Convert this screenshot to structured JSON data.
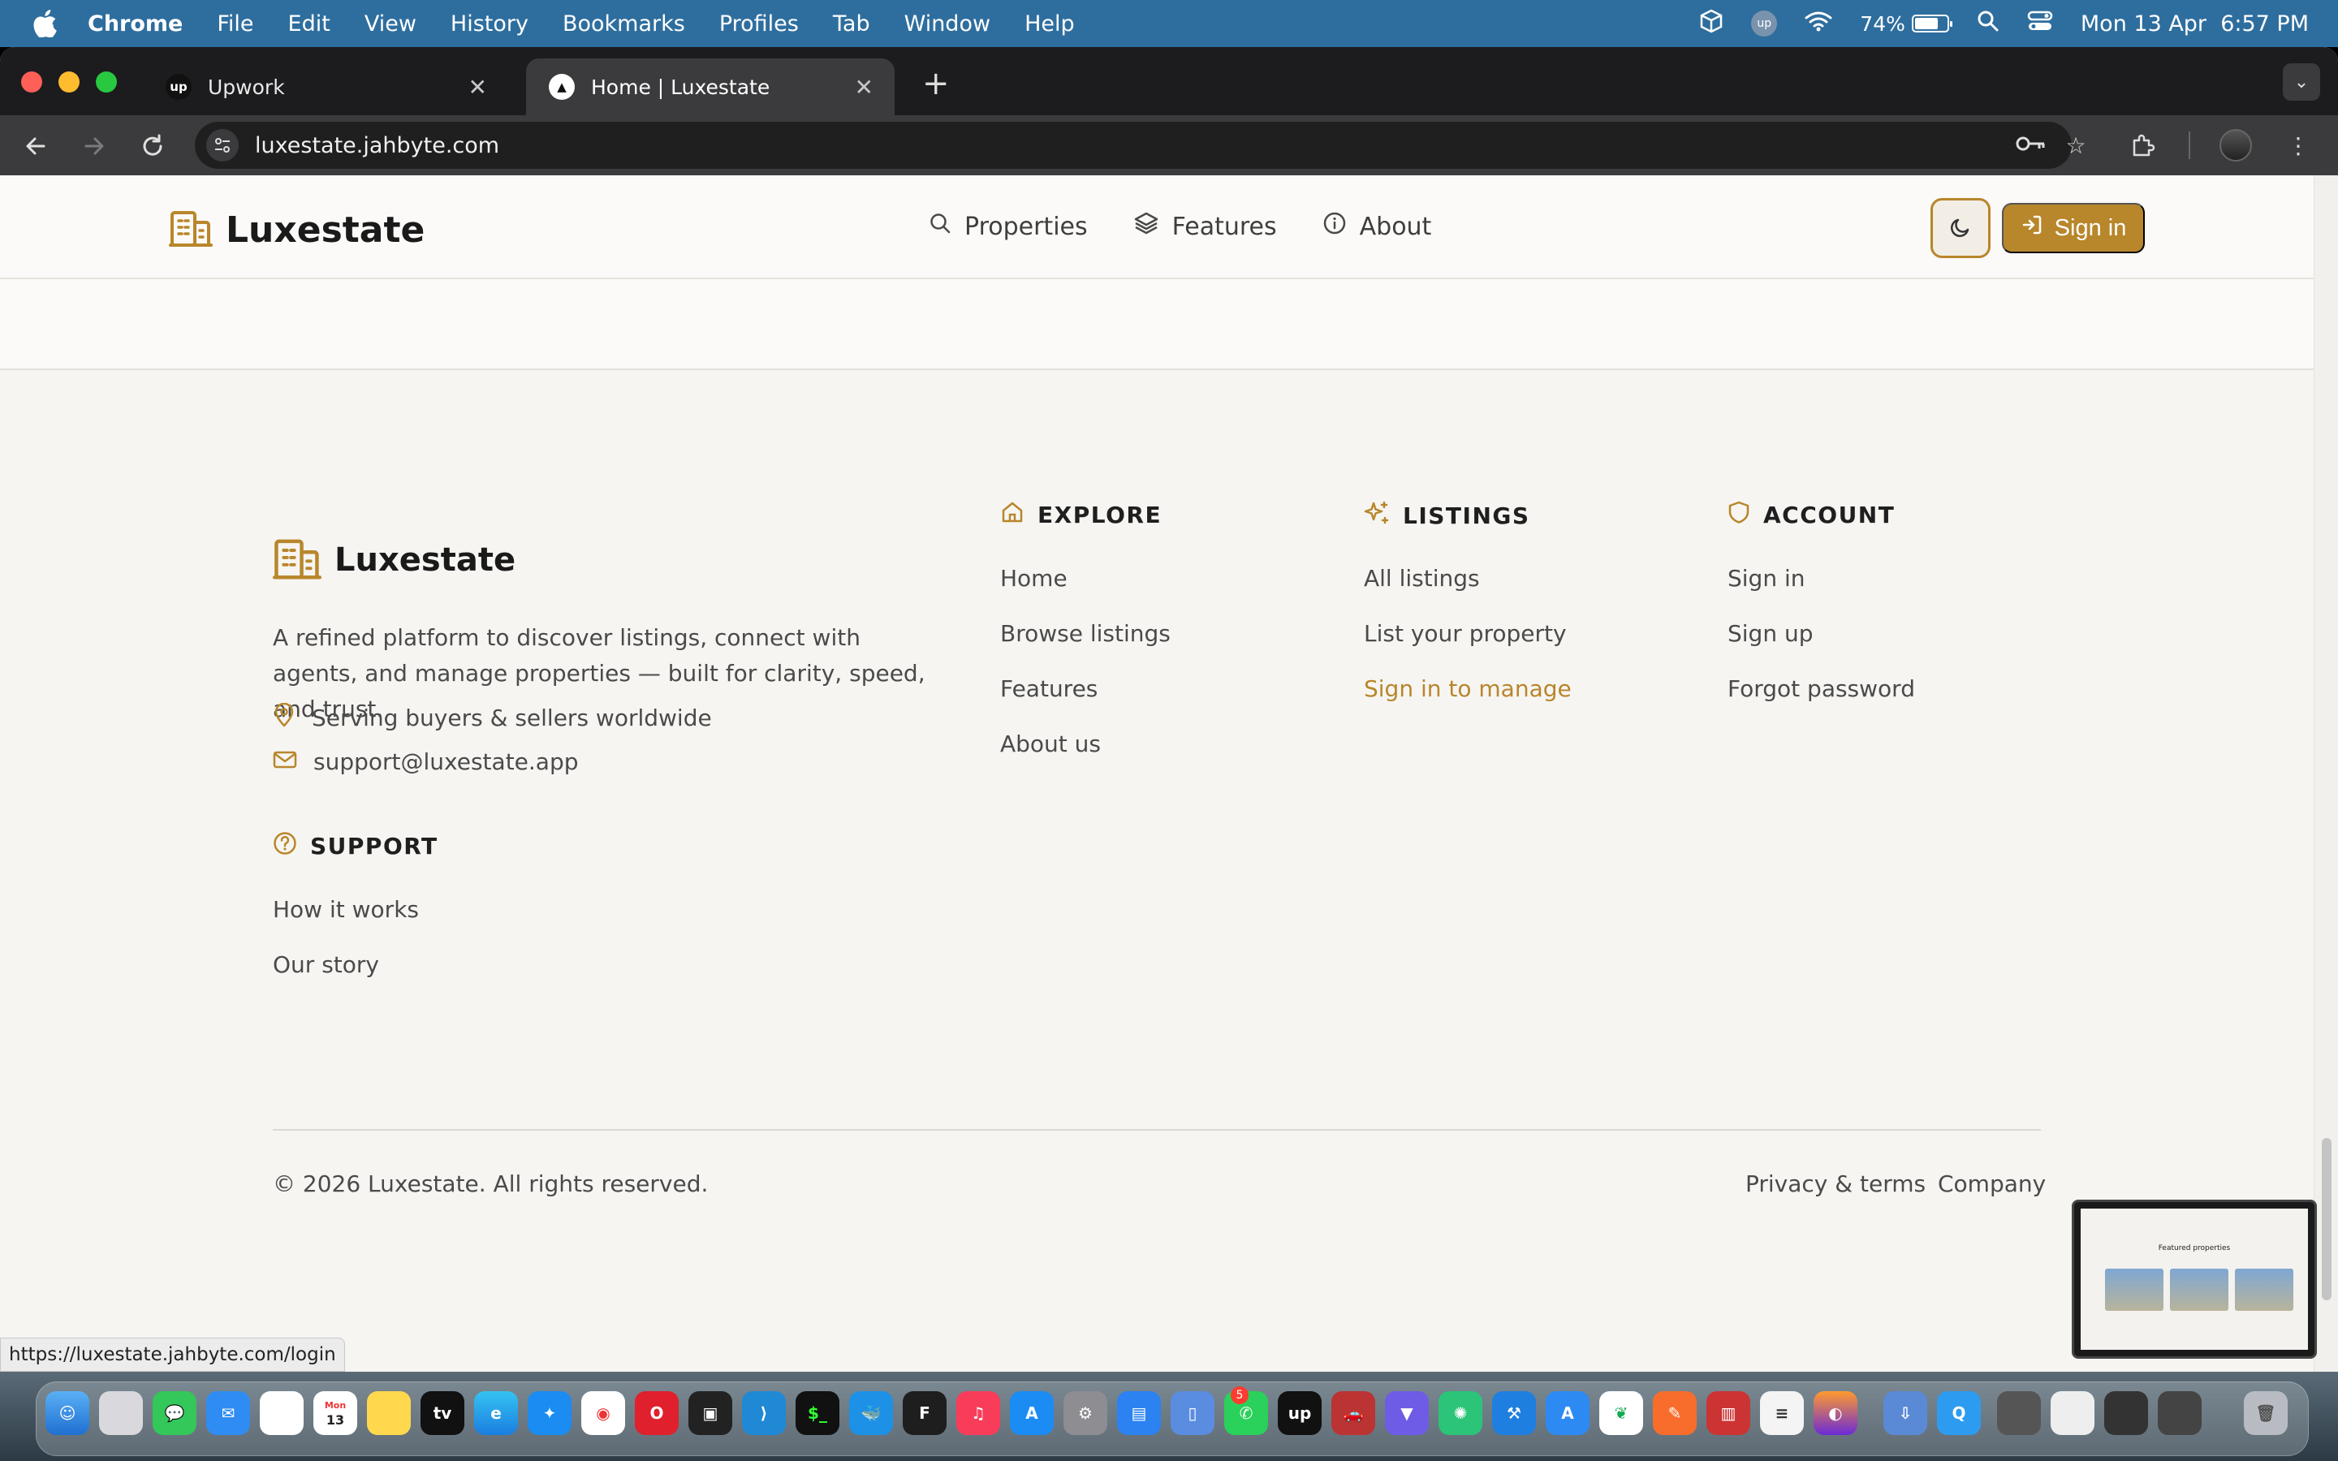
{
  "menubar": {
    "app_name": "Chrome",
    "items": [
      "File",
      "Edit",
      "View",
      "History",
      "Bookmarks",
      "Profiles",
      "Tab",
      "Window",
      "Help"
    ],
    "battery_percent": "74%",
    "battery_level": 0.74,
    "datetime": "Mon 13 Apr  6:57 PM"
  },
  "browser": {
    "tabs": [
      {
        "title": "Upwork",
        "favicon": "up",
        "active": false
      },
      {
        "title": "Home | Luxestate",
        "favicon": "▲",
        "active": true
      }
    ],
    "url": "luxestate.jahbyte.com",
    "status_url": "https://luxestate.jahbyte.com/login"
  },
  "site": {
    "brand": "Luxestate",
    "accent_color": "#b8862b",
    "nav": [
      {
        "label": "Properties",
        "icon": "search-icon"
      },
      {
        "label": "Features",
        "icon": "layers-icon"
      },
      {
        "label": "About",
        "icon": "info-icon"
      }
    ],
    "signin_label": "Sign in"
  },
  "footer": {
    "brand": "Luxestate",
    "description": "A refined platform to discover listings, connect with agents, and manage properties — built for clarity, speed, and trust.",
    "location": "Serving buyers & sellers worldwide",
    "email": "support@luxestate.app",
    "support": {
      "title": "SUPPORT",
      "links": [
        "How it works",
        "Our story"
      ]
    },
    "explore": {
      "title": "EXPLORE",
      "links": [
        "Home",
        "Browse listings",
        "Features",
        "About us"
      ]
    },
    "listings": {
      "title": "LISTINGS",
      "links": [
        "All listings",
        "List your property",
        "Sign in to manage"
      ]
    },
    "account": {
      "title": "ACCOUNT",
      "links": [
        "Sign in",
        "Sign up",
        "Forgot password"
      ]
    },
    "copyright": "© 2026 Luxestate. All rights reserved.",
    "legal": [
      "Privacy & terms",
      "Company"
    ]
  },
  "pip": {
    "title": "Featured properties"
  },
  "dock": {
    "badge_count": "5",
    "calendar_day": "13",
    "calendar_month": "Mon"
  }
}
